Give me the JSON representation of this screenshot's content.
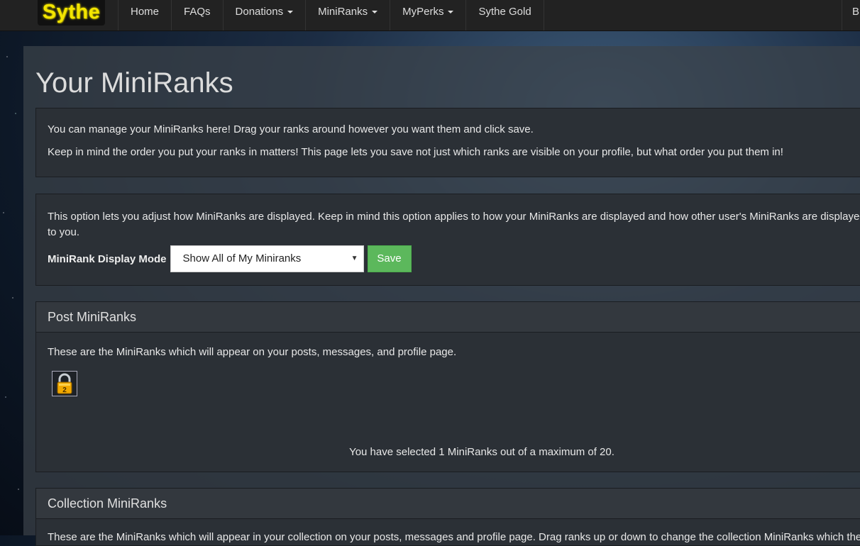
{
  "nav": {
    "logo": "Sythe",
    "items": [
      {
        "label": "Home",
        "dropdown": false
      },
      {
        "label": "FAQs",
        "dropdown": false
      },
      {
        "label": "Donations",
        "dropdown": true
      },
      {
        "label": "MiniRanks",
        "dropdown": true
      },
      {
        "label": "MyPerks",
        "dropdown": true
      },
      {
        "label": "Sythe Gold",
        "dropdown": false
      }
    ],
    "right_partial": "B"
  },
  "page": {
    "title": "Your MiniRanks"
  },
  "intro": {
    "line1": "You can manage your MiniRanks here! Drag your ranks around however you want them and click save.",
    "line2": "Keep in mind the order you put your ranks in matters! This page lets you save not just which ranks are visible on your profile, but what order you put them in!"
  },
  "display_mode": {
    "description": "This option lets you adjust how MiniRanks are displayed. Keep in mind this option applies to how your MiniRanks are displayed and how other user's MiniRanks are displayed to you.",
    "label": "MiniRank Display Mode",
    "selected": "Show All of My Miniranks",
    "save_label": "Save"
  },
  "post_miniranks": {
    "heading": "Post MiniRanks",
    "description": "These are the MiniRanks which will appear on your posts, messages, and profile page.",
    "icon": "padlock-icon",
    "count_text": "You have selected 1 MiniRanks out of a maximum of 20."
  },
  "collection_miniranks": {
    "heading": "Collection MiniRanks",
    "description_partial": "These are the MiniRanks which will appear in your collection on your posts, messages and profile page. Drag ranks up or down to change the collection MiniRanks which the"
  },
  "colors": {
    "save_button": "#5cb85c",
    "logo": "#f3e500"
  }
}
